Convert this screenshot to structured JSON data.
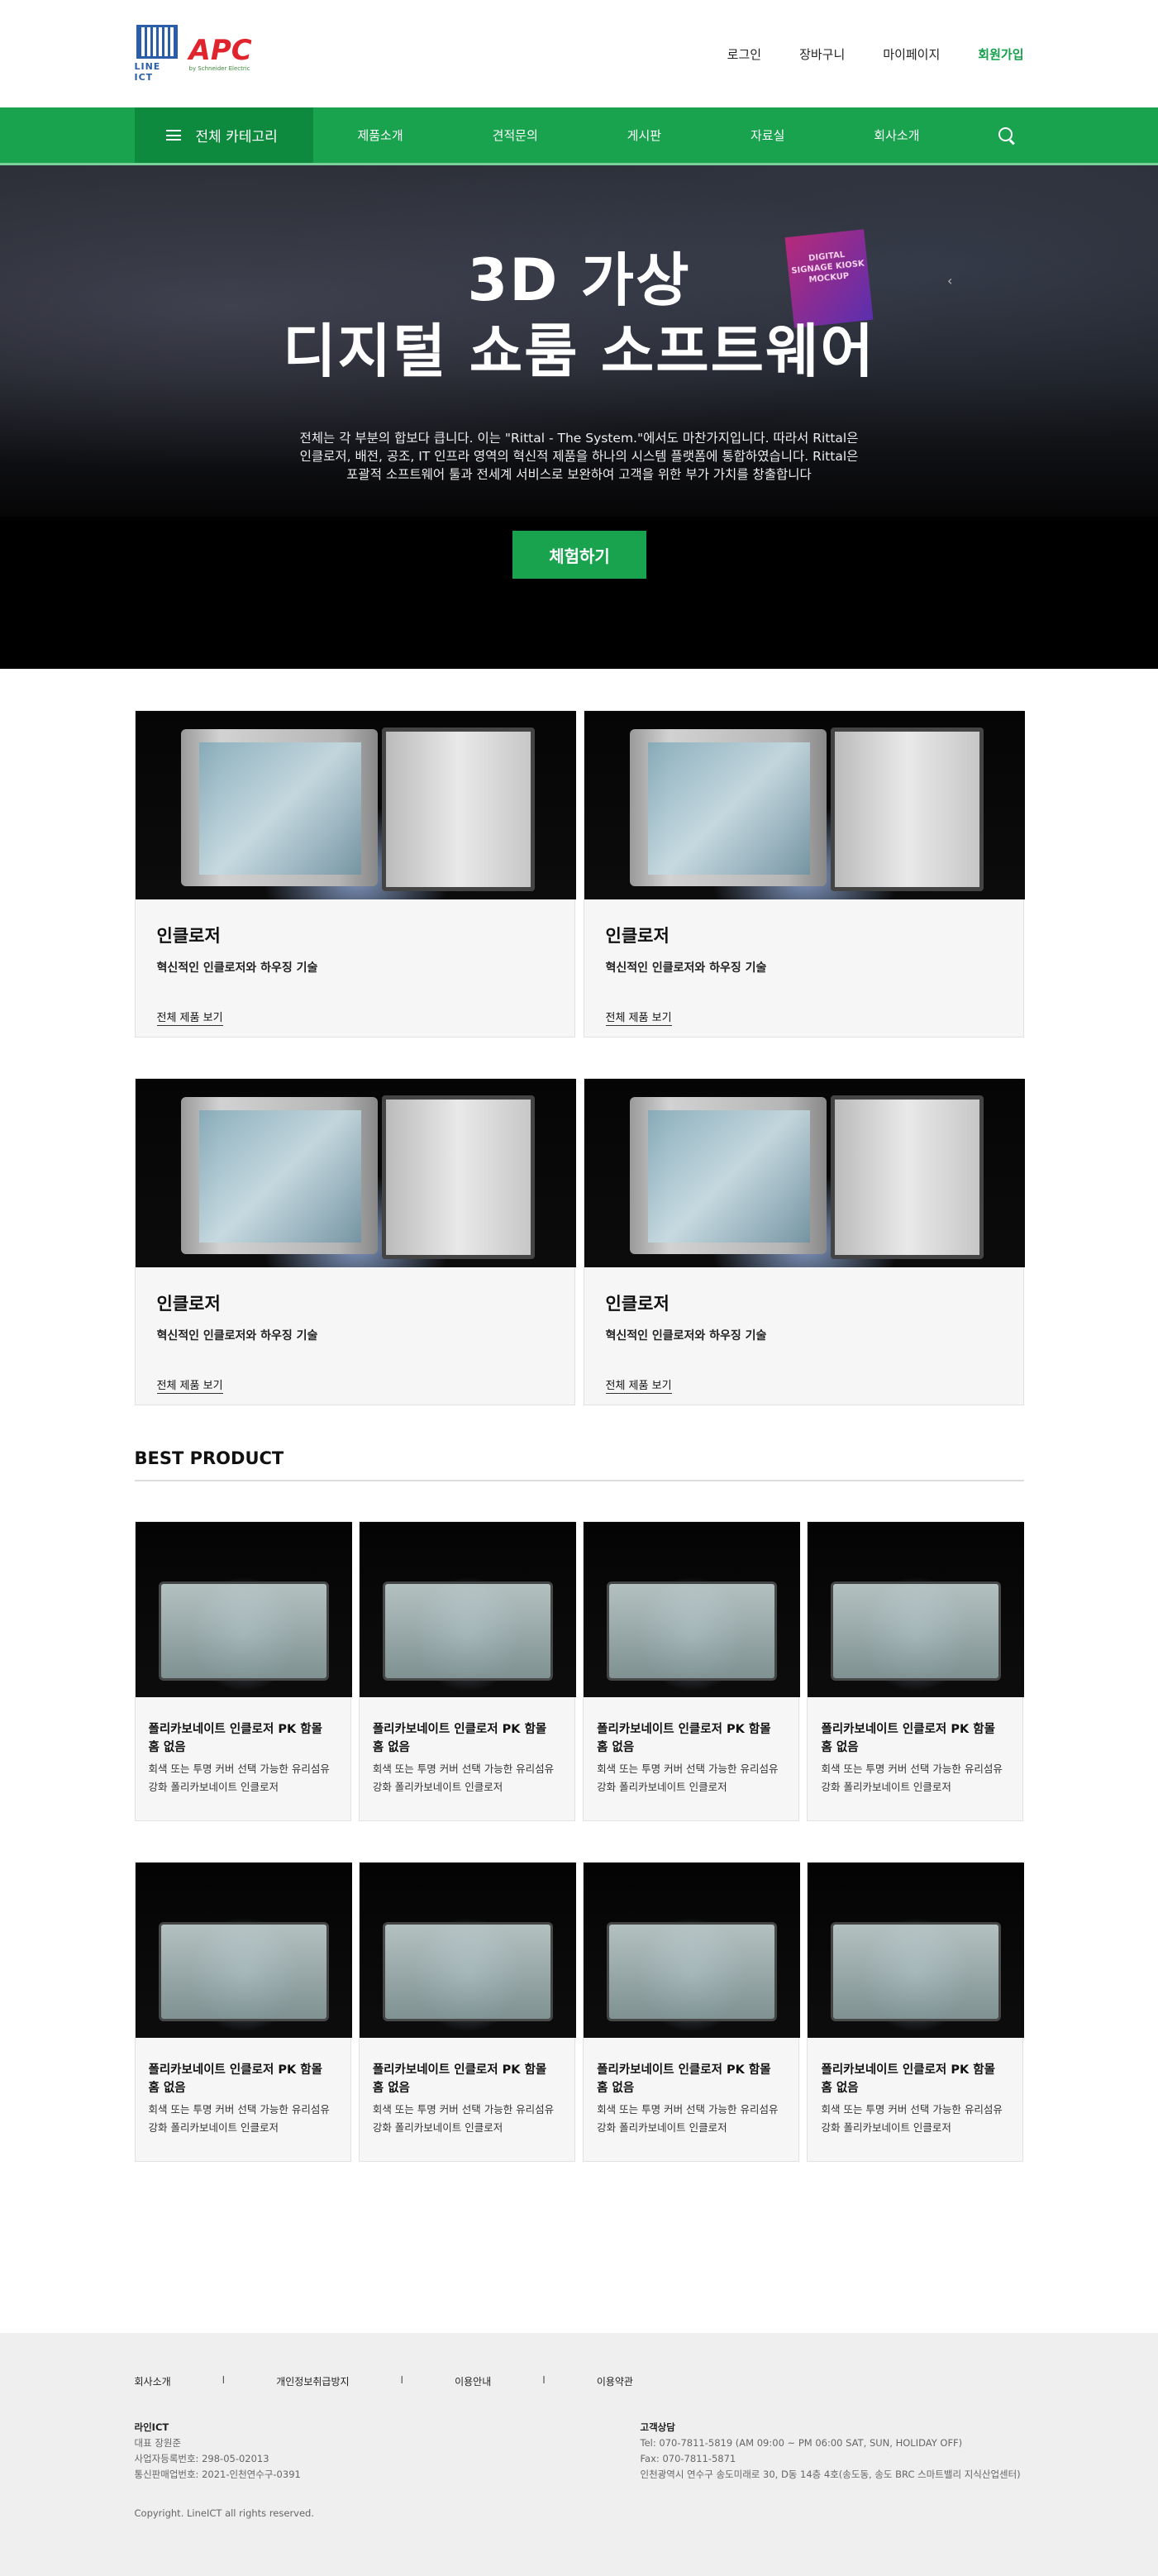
{
  "header": {
    "logo_line_text": "LINE ICT",
    "logo_apc_text": "APC",
    "logo_apc_sub": "by Schneider Electric",
    "links": [
      {
        "label": "로그인"
      },
      {
        "label": "장바구니"
      },
      {
        "label": "마이페이지"
      },
      {
        "label": "회원가입"
      }
    ]
  },
  "nav": {
    "category_label": "전체 카테고리",
    "items": [
      {
        "label": "제품소개"
      },
      {
        "label": "견적문의"
      },
      {
        "label": "게시판"
      },
      {
        "label": "자료실"
      },
      {
        "label": "회사소개"
      }
    ],
    "search_icon": "search-icon"
  },
  "hero": {
    "kiosk_text": "DIGITAL SIGNAGE KIOSK MOCKUP",
    "title_line1": "3D 가상",
    "title_line2": "디지털 쇼룸 소프트웨어",
    "desc_line1": "전체는 각 부분의 합보다 큽니다. 이는 \"Rittal - The System.\"에서도 마찬가지입니다. 따라서 Rittal은",
    "desc_line2": "인클로저, 배전, 공조, IT 인프라 영역의 혁신적 제품을 하나의 시스템 플랫폼에 통합하였습니다. Rittal은",
    "desc_line3": "포괄적 소프트웨어 툴과 전세계 서비스로 보완하여 고객을 위한 부가 가치를 창출합니다",
    "button_label": "체험하기",
    "arrow": "‹"
  },
  "categories": [
    {
      "title": "인클로저",
      "subtitle": "혁신적인 인클로저와 하우징 기술",
      "link": "전체 제품 보기"
    },
    {
      "title": "인클로저",
      "subtitle": "혁신적인 인클로저와 하우징 기술",
      "link": "전체 제품 보기"
    },
    {
      "title": "인클로저",
      "subtitle": "혁신적인 인클로저와 하우징 기술",
      "link": "전체 제품 보기"
    },
    {
      "title": "인클로저",
      "subtitle": "혁신적인 인클로저와 하우징 기술",
      "link": "전체 제품 보기"
    }
  ],
  "best": {
    "heading": "BEST PRODUCT",
    "products": [
      {
        "name": "폴리카보네이트 인클로저 PK 함몰 홈 없음",
        "desc": "회색 또는 투명 커버 선택 가능한 유리섬유 강화 폴리카보네이트 인클로저"
      },
      {
        "name": "폴리카보네이트 인클로저 PK 함몰 홈 없음",
        "desc": "회색 또는 투명 커버 선택 가능한 유리섬유 강화 폴리카보네이트 인클로저"
      },
      {
        "name": "폴리카보네이트 인클로저 PK 함몰 홈 없음",
        "desc": "회색 또는 투명 커버 선택 가능한 유리섬유 강화 폴리카보네이트 인클로저"
      },
      {
        "name": "폴리카보네이트 인클로저 PK 함몰 홈 없음",
        "desc": "회색 또는 투명 커버 선택 가능한 유리섬유 강화 폴리카보네이트 인클로저"
      },
      {
        "name": "폴리카보네이트 인클로저 PK 함몰 홈 없음",
        "desc": "회색 또는 투명 커버 선택 가능한 유리섬유 강화 폴리카보네이트 인클로저"
      },
      {
        "name": "폴리카보네이트 인클로저 PK 함몰 홈 없음",
        "desc": "회색 또는 투명 커버 선택 가능한 유리섬유 강화 폴리카보네이트 인클로저"
      },
      {
        "name": "폴리카보네이트 인클로저 PK 함몰 홈 없음",
        "desc": "회색 또는 투명 커버 선택 가능한 유리섬유 강화 폴리카보네이트 인클로저"
      },
      {
        "name": "폴리카보네이트 인클로저 PK 함몰 홈 없음",
        "desc": "회색 또는 투명 커버 선택 가능한 유리섬유 강화 폴리카보네이트 인클로저"
      }
    ]
  },
  "footer": {
    "links": [
      {
        "label": "회사소개"
      },
      {
        "label": "개인정보취급방지"
      },
      {
        "label": "이용안내"
      },
      {
        "label": "이용약관"
      }
    ],
    "separator": "I",
    "company": {
      "name": "라인ICT",
      "ceo": "대표 장원준",
      "biz_no": "사업자등록번호: 298-05-02013",
      "mail_order": "통신판매업번호: 2021-인천연수구-0391"
    },
    "support": {
      "title": "고객상담",
      "tel": "Tel: 070-7811-5819  (AM 09:00 ~ PM 06:00  SAT, SUN, HOLIDAY OFF)",
      "fax": "Fax: 070-7811-5871",
      "address": "인천광역시 연수구 송도미래로 30, D동 14층 4호(송도동, 송도 BRC 스마트밸리 지식산업센터)"
    },
    "copyright": "Copyright. LineICT all rights reserved."
  },
  "colors": {
    "brand_green": "#19a34e",
    "dark_green": "#0e8a3e",
    "apc_red": "#e0242d"
  }
}
